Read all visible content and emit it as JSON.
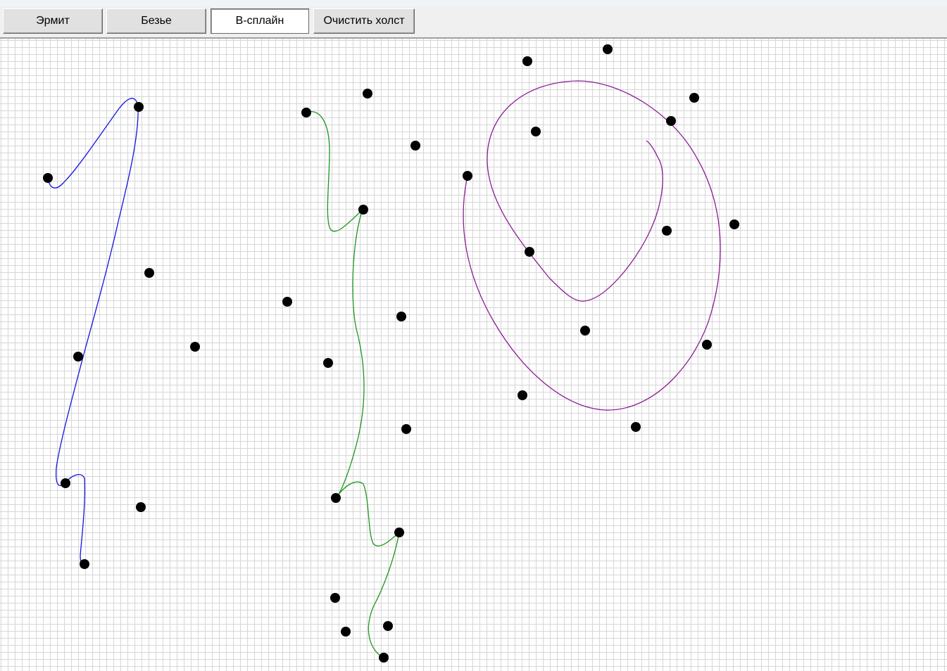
{
  "toolbar": {
    "buttons": [
      {
        "id": "hermite",
        "label": "Эрмит",
        "active": false
      },
      {
        "id": "bezier",
        "label": "Безье",
        "active": false
      },
      {
        "id": "bspline",
        "label": "B-сплайн",
        "active": true
      },
      {
        "id": "clear",
        "label": "Очистить холст",
        "active": false
      }
    ]
  },
  "colors": {
    "hermite_curve": "#1414e6",
    "bezier_curve": "#1e961e",
    "bspline_curve": "#8c1e96",
    "control_point": "#000000",
    "grid_line": "#d6d6d6",
    "canvas_background": "#ffffff"
  }
}
